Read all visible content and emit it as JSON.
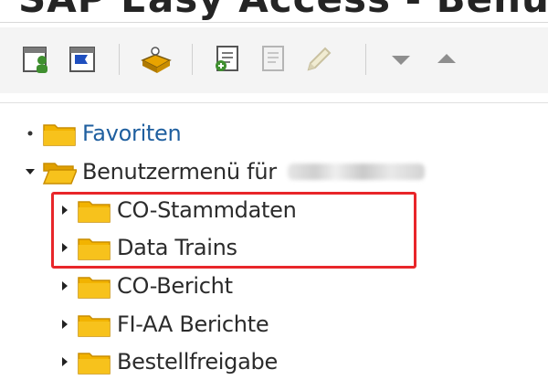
{
  "window": {
    "title": "SAP Easy Access - Benutzerm"
  },
  "toolbar": {
    "buttons": [
      {
        "icon": "user-menu-icon"
      },
      {
        "icon": "sap-menu-icon"
      },
      {
        "icon": "add-favorite-icon"
      },
      {
        "icon": "other-menu-icon"
      },
      {
        "icon": "assign-users-icon"
      },
      {
        "icon": "edit-pencil-icon"
      },
      {
        "icon": "arrow-down-icon"
      },
      {
        "icon": "arrow-up-icon"
      }
    ]
  },
  "tree": {
    "favorites": {
      "label": "Favoriten"
    },
    "user_menu": {
      "label": "Benutzermenü für"
    },
    "items": [
      {
        "label": "CO-Stammdaten"
      },
      {
        "label": "Data Trains"
      },
      {
        "label": "CO-Bericht"
      },
      {
        "label": "FI-AA Berichte"
      },
      {
        "label": "Bestellfreigabe"
      }
    ]
  },
  "colors": {
    "folder": "#f2b300",
    "folder_dark": "#c98d00",
    "link": "#1f5f9f",
    "highlight": "#e8262a"
  }
}
